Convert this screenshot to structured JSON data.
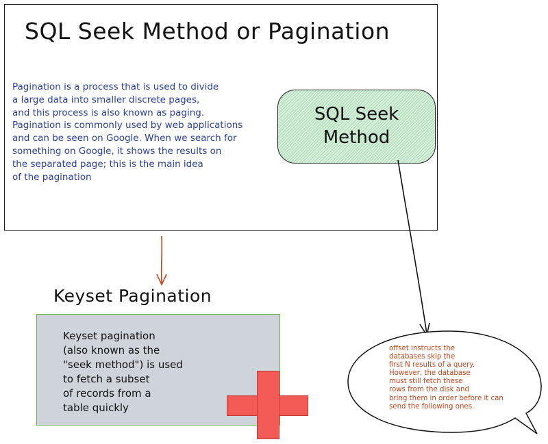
{
  "title": "SQL Seek Method or Pagination",
  "intro_text": "Pagination is a process that is used to divide\na large data  into smaller discrete pages,\nand this process is also known as paging.\nPagination is commonly used by web applications\nand can be seen on Google. When we search for\n something on Google, it shows the results on\nthe separated page; this is the main idea\nof the pagination",
  "seek_method_label": "SQL Seek\nMethod",
  "keyset_title": "Keyset Pagination",
  "keyset_text": "Keyset pagination\n(also known as the\n\"seek method\") is used\nto fetch a subset\nof records from a\ntable quickly",
  "offset_note": "offset instructs the\ndatabases skip the\nfirst N results of a query.\nHowever, the database\nmust still fetch these\nrows from the disk and\nbring them in order before it can\nsend the following ones.",
  "colors": {
    "intro_text": "#2b3fa3",
    "note_text": "#c4451a",
    "seek_fill": "#a7d8b0",
    "keyset_fill": "#ced4da",
    "keyset_border": "#6fb357",
    "cross": "#f25a55",
    "down_arrow": "#c4451a"
  }
}
